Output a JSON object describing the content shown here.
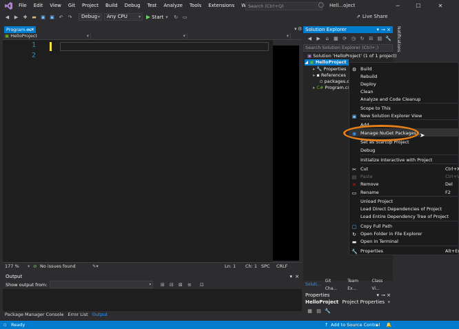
{
  "menubar": {
    "items": [
      "File",
      "Edit",
      "View",
      "Git",
      "Project",
      "Build",
      "Debug",
      "Test",
      "Analyze",
      "Tools",
      "Extensions",
      "Window",
      "Help"
    ],
    "search_placeholder": "Search (Ctrl+Q)",
    "title": "Hell...oject"
  },
  "toolbar": {
    "config": "Debug",
    "platform": "Any CPU",
    "start_label": "Start",
    "live_share": "Live Share"
  },
  "editor": {
    "tab_title": "Program.cs*",
    "nav_project": "HelloProject",
    "line_numbers": [
      "1",
      "2"
    ],
    "zoom": "177 %",
    "issues": "No issues found",
    "ln": "Ln: 1",
    "ch": "Ch: 1",
    "spc": "SPC",
    "crlf": "CRLF"
  },
  "output": {
    "title": "Output",
    "show_from": "Show output from:",
    "tabs": [
      "Package Manager Console",
      "Error List",
      "Output"
    ]
  },
  "solution_explorer": {
    "title": "Solution Explorer",
    "search_placeholder": "Search Solution Explorer (Ctrl+;)",
    "solution_label": "Solution 'HelloProject' (1 of 1 project)",
    "project_label": "HelloProject",
    "children": [
      "Properties",
      "References",
      "packages.c",
      "Program.cs"
    ],
    "bottom_tabs": [
      "Soluti...",
      "Git Cha...",
      "Team Ex...",
      "Class Vi..."
    ]
  },
  "properties": {
    "title": "Properties",
    "subject": "HelloProject",
    "subject_type": "Project Properties"
  },
  "notifications": "Notifications",
  "context_menu": {
    "items": [
      {
        "label": "Build",
        "icon": "build-icon",
        "shortcut": ""
      },
      {
        "label": "Rebuild",
        "icon": "",
        "shortcut": ""
      },
      {
        "label": "Deploy",
        "icon": "",
        "shortcut": ""
      },
      {
        "label": "Clean",
        "icon": "",
        "shortcut": ""
      },
      {
        "label": "Analyze and Code Cleanup",
        "icon": "",
        "shortcut": ""
      },
      {
        "label": "Scope to This",
        "icon": "",
        "shortcut": ""
      },
      {
        "label": "New Solution Explorer View",
        "icon": "new-view-icon",
        "shortcut": ""
      },
      {
        "label": "Add",
        "icon": "",
        "shortcut": ""
      },
      {
        "label": "Manage NuGet Packages...",
        "icon": "nuget-icon",
        "shortcut": ""
      },
      {
        "label": "Set as Startup Project",
        "icon": "",
        "shortcut": ""
      },
      {
        "label": "Debug",
        "icon": "",
        "shortcut": ""
      },
      {
        "label": "Initialize Interactive with Project",
        "icon": "",
        "shortcut": ""
      },
      {
        "label": "Cut",
        "icon": "cut-icon",
        "shortcut": "Ctrl+X"
      },
      {
        "label": "Paste",
        "icon": "paste-icon",
        "shortcut": "Ctrl+V"
      },
      {
        "label": "Remove",
        "icon": "remove-icon",
        "shortcut": "Del"
      },
      {
        "label": "Rename",
        "icon": "rename-icon",
        "shortcut": "F2"
      },
      {
        "label": "Unload Project",
        "icon": "",
        "shortcut": ""
      },
      {
        "label": "Load Direct Dependencies of Project",
        "icon": "",
        "shortcut": ""
      },
      {
        "label": "Load Entire Dependency Tree of Project",
        "icon": "",
        "shortcut": ""
      },
      {
        "label": "Copy Full Path",
        "icon": "copy-icon",
        "shortcut": ""
      },
      {
        "label": "Open Folder in File Explorer",
        "icon": "folder-icon",
        "shortcut": ""
      },
      {
        "label": "Open in Terminal",
        "icon": "terminal-icon",
        "shortcut": ""
      },
      {
        "label": "Properties",
        "icon": "wrench-icon",
        "shortcut": "Alt+Ent"
      }
    ],
    "highlighted_index": 8
  },
  "statusbar": {
    "ready": "Ready",
    "source_control": "Add to Source Control"
  },
  "colors": {
    "accent": "#007acc",
    "highlight_oval": "#e57f17"
  }
}
